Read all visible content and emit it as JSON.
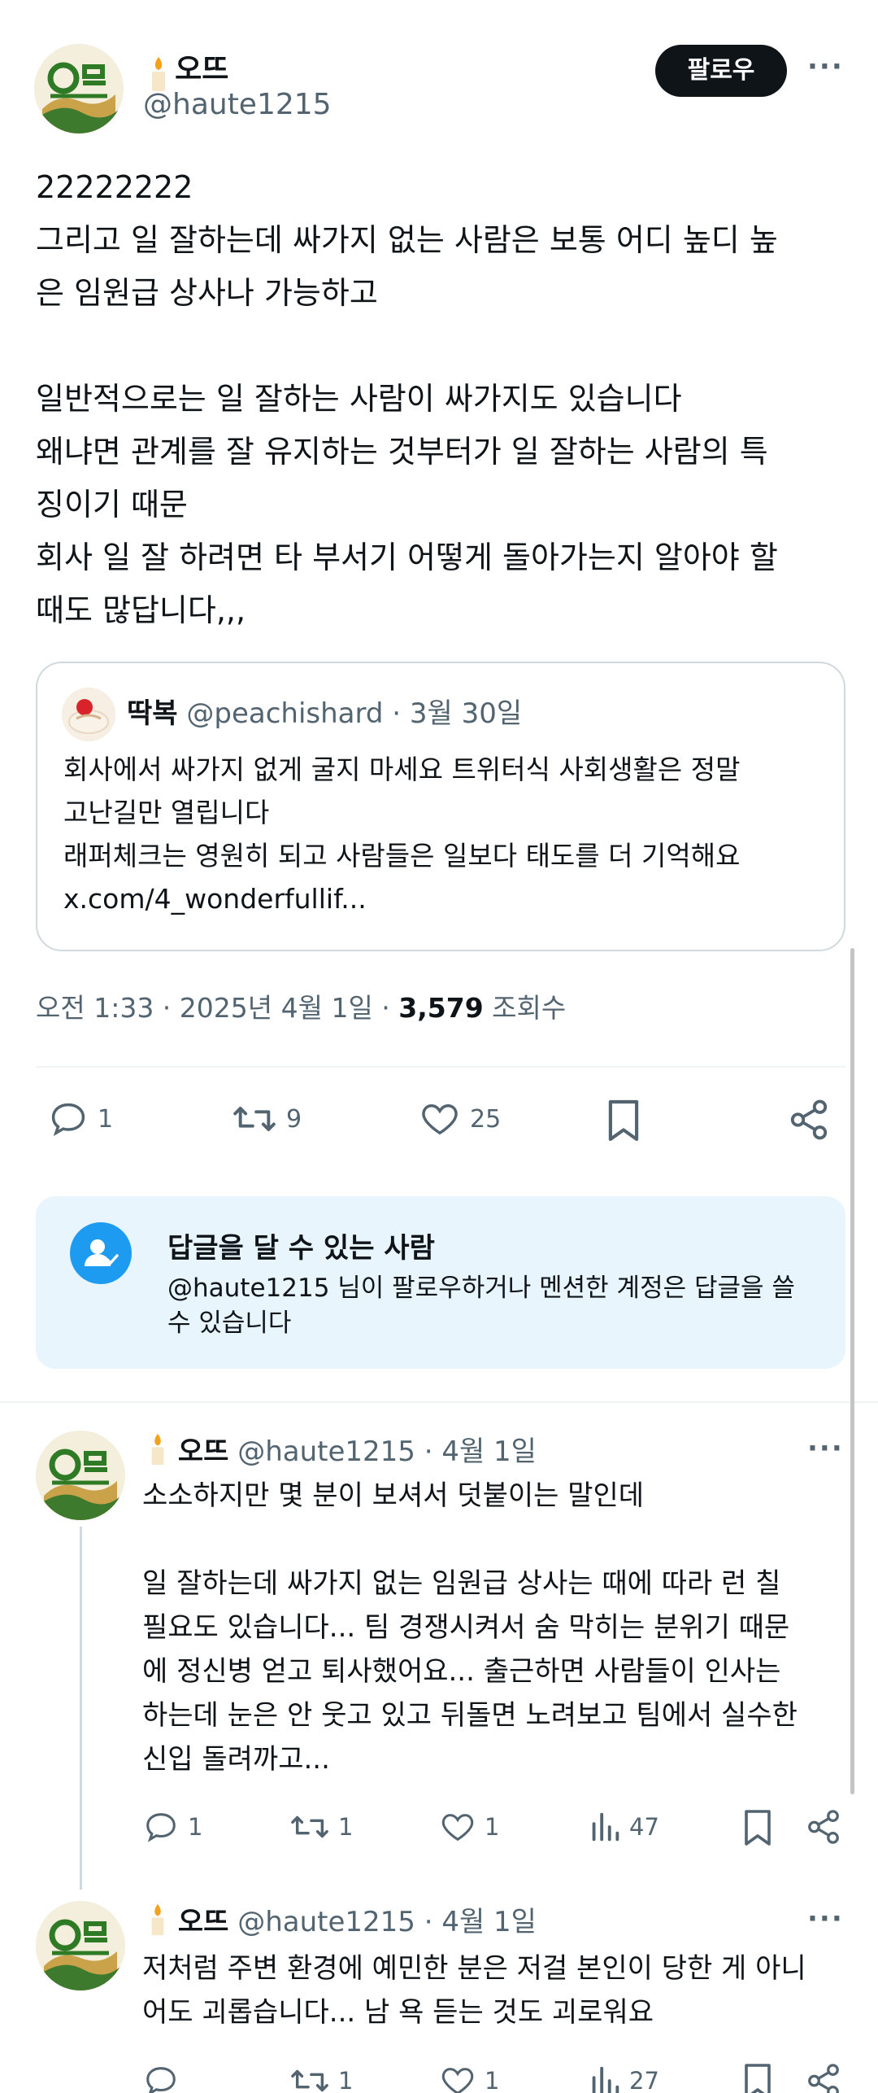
{
  "author": {
    "name": "오뜨",
    "handle": "@haute1215",
    "avatar_icon": "avatar-logo-icon",
    "name_emoji": "candle-icon"
  },
  "header": {
    "follow_label": "팔로우",
    "more_icon": "more-icon"
  },
  "tweet": {
    "text": "22222222\n그리고 일 잘하는데 싸가지 없는 사람은 보통 어디 높디 높\n은 임원급 상사나 가능하고\n\n일반적으로는 일 잘하는 사람이 싸가지도 있습니다\n왜냐면 관계를 잘 유지하는 것부터가 일 잘하는 사람의 특\n징이기 때문\n회사 일 잘 하려면 타 부서기 어떻게 돌아가는지 알아야 할\n때도 많답니다,,,"
  },
  "quote": {
    "name": "딱복",
    "handle": "@peachishard",
    "date": "· 3월 30일",
    "text": "회사에서 싸가지 없게 굴지 마세요 트위터식 사회생활은 정말\n고난길만 열립니다\n래퍼체크는 영원히 되고 사람들은 일보다 태도를 더 기억해요\nx.com/4_wonderfullif..."
  },
  "meta": {
    "time": "오전 1:33 · 2025년 4월 1일 · ",
    "views_count": "3,579",
    "views_label": " 조회수"
  },
  "actions": {
    "reply_count": "1",
    "retweet_count": "9",
    "like_count": "25"
  },
  "who_can_reply": {
    "title": "답글을 달 수 있는 사람",
    "description": "@haute1215 님이 팔로우하거나 멘션한 계정은 답글을 쓸 수 있습니다"
  },
  "replies": [
    {
      "name": "오뜨",
      "handle": "@haute1215",
      "date": "· 4월 1일",
      "text": "소소하지만 몇 분이 보셔서 덧붙이는 말인데\n\n일 잘하는데 싸가지 없는 임원급 상사는 때에 따라 런 칠\n필요도 있습니다... 팀 경쟁시켜서 숨 막히는 분위기 때문\n에 정신병 얻고 퇴사했어요... 출근하면 사람들이 인사는\n하는데 눈은 안 웃고 있고 뒤돌면 노려보고 팀에서 실수한\n신입 돌려까고...",
      "reply_count": "1",
      "retweet_count": "1",
      "like_count": "1",
      "views_count": "47"
    },
    {
      "name": "오뜨",
      "handle": "@haute1215",
      "date": "· 4월 1일",
      "text": "저처럼 주변 환경에 예민한 분은 저걸 본인이 당한 게 아니\n어도 괴롭습니다... 남 욕 듣는 것도 괴로워요",
      "reply_count": "",
      "retweet_count": "1",
      "like_count": "1",
      "views_count": "27"
    }
  ],
  "colors": {
    "text": "#0f1419",
    "secondary": "#536471",
    "accent": "#1d9bf0",
    "reply_card_bg": "#e8f5fd"
  }
}
